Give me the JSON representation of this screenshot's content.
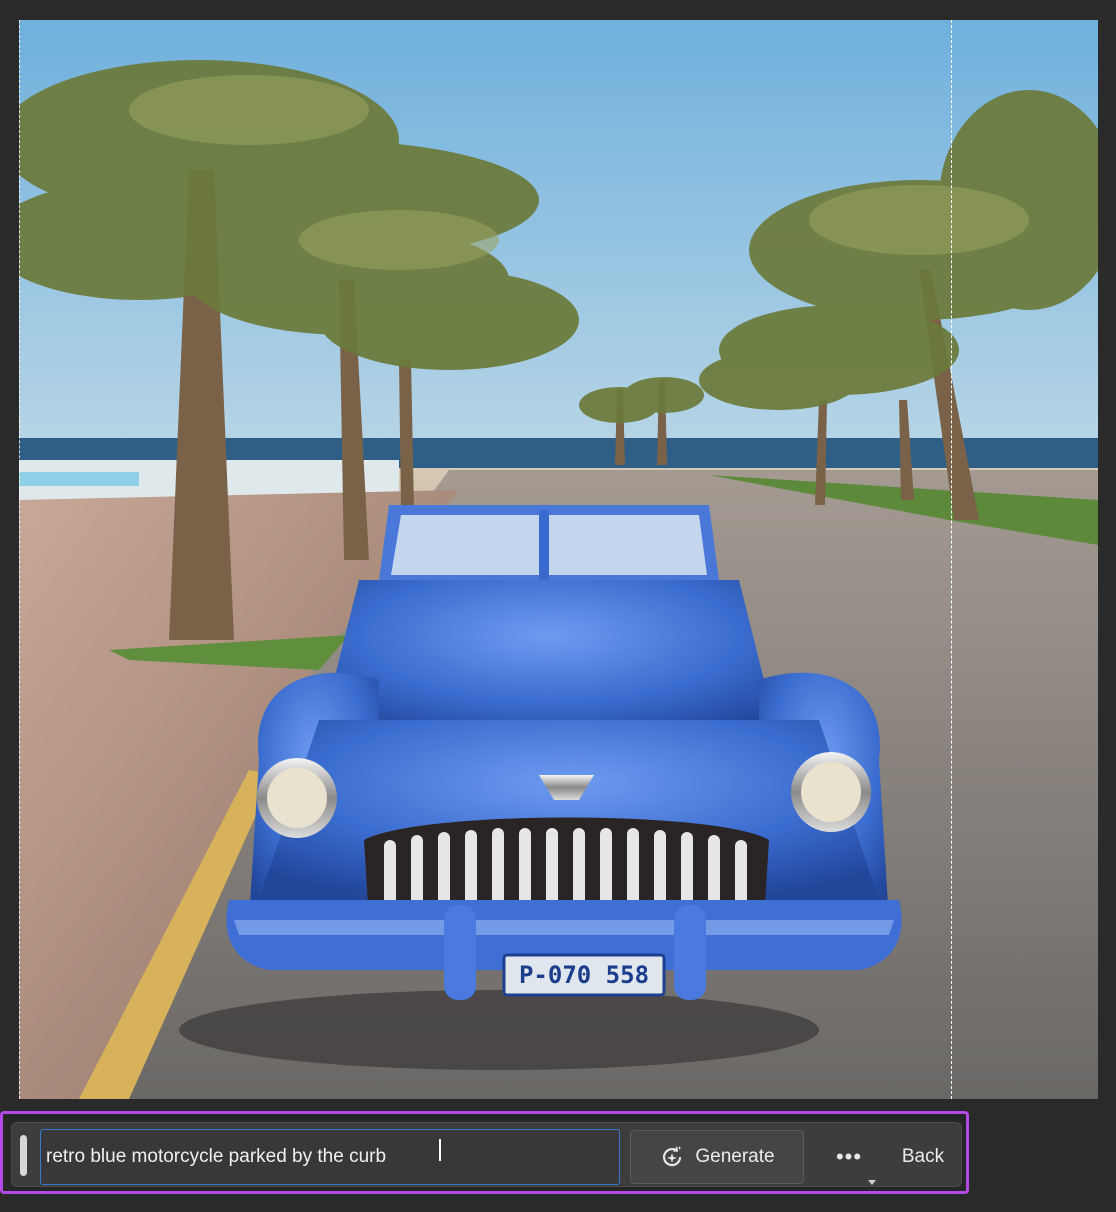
{
  "canvas": {
    "image_subject": "blue-vintage-convertible-photo",
    "plate_text": "P-070 558"
  },
  "taskbar": {
    "prompt_value": "retro blue motorcycle parked by the curb",
    "generate_label": "Generate",
    "more_label": "•••",
    "back_label": "Back",
    "icons": {
      "generate": "sparkle-refresh-icon",
      "more": "more-options-icon",
      "grip": "drag-handle-icon"
    },
    "colors": {
      "highlight": "#b14ae6",
      "focus": "#3a78c9",
      "car_blue": "#3a6ccf"
    }
  }
}
